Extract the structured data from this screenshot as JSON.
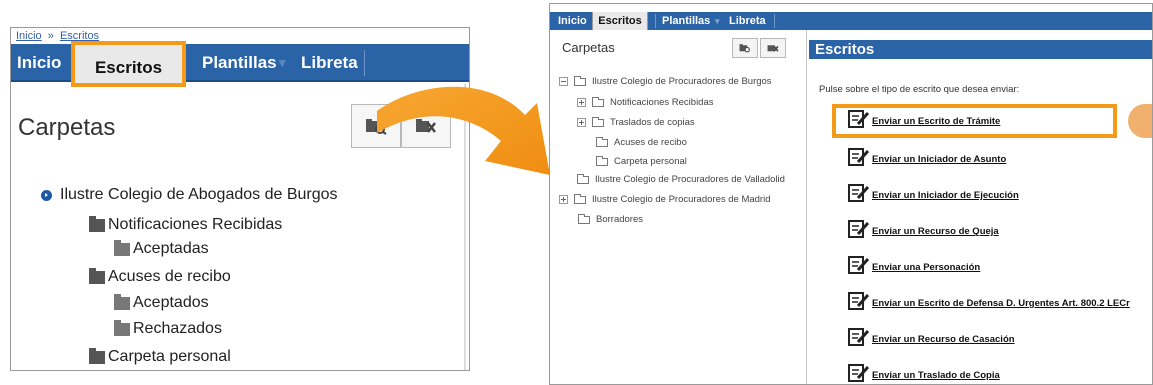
{
  "left_panel": {
    "breadcrumb": {
      "home": "Inicio",
      "separator": "»",
      "current": "Escritos"
    },
    "nav": {
      "inicio": "Inicio",
      "escritos": "Escritos",
      "plantillas": "Plantillas",
      "libreta": "Libreta",
      "dropdown_glyph": "▾"
    },
    "carpetas_label": "Carpetas",
    "tree": [
      {
        "label": "Ilustre Colegio de Abogados de Burgos",
        "icon": "chevron-bullet-icon"
      },
      {
        "label": "Notificaciones Recibidas",
        "icon": "folder-icon"
      },
      {
        "label": "Aceptadas",
        "icon": "folder-icon"
      },
      {
        "label": "Acuses de recibo",
        "icon": "folder-icon"
      },
      {
        "label": "Aceptados",
        "icon": "folder-icon"
      },
      {
        "label": "Rechazados",
        "icon": "folder-icon"
      },
      {
        "label": "Carpeta personal",
        "icon": "folder-icon"
      }
    ]
  },
  "right_panel": {
    "nav": {
      "inicio": "Inicio",
      "escritos": "Escritos",
      "plantillas": "Plantillas",
      "libreta": "Libreta",
      "dropdown_glyph": "▾"
    },
    "carpetas_label": "Carpetas",
    "tree": [
      {
        "label": "Ilustre Colegio de Procuradores de Burgos",
        "expander": "minus"
      },
      {
        "label": "Notificaciones Recibidas",
        "expander": "plus"
      },
      {
        "label": "Traslados de copias",
        "expander": "plus"
      },
      {
        "label": "Acuses de recibo",
        "expander": "none"
      },
      {
        "label": "Carpeta personal",
        "expander": "none"
      },
      {
        "label": "Ilustre Colegio de Procuradores de Valladolid",
        "expander": "none"
      },
      {
        "label": "Ilustre Colegio de Procuradores de Madrid",
        "expander": "plus"
      },
      {
        "label": "Borradores",
        "expander": "none"
      }
    ],
    "content_title": "Escritos",
    "instruction": "Pulse sobre el tipo de escrito que desea enviar:",
    "links": [
      "Enviar un Escrito de Trámite",
      "Enviar un Iniciador de Asunto",
      "Enviar un Iniciador de Ejecución",
      "Enviar un Recurso de Queja",
      "Enviar una Personación",
      "Enviar un Escrito de Defensa D. Urgentes Art. 800.2 LECr",
      "Enviar un Recurso de Casación",
      "Enviar un Traslado de Copia"
    ]
  },
  "colors": {
    "nav_blue": "#2a63a6",
    "highlight_orange": "#f39a1a",
    "tab_active_bg": "#e9e9e9"
  }
}
